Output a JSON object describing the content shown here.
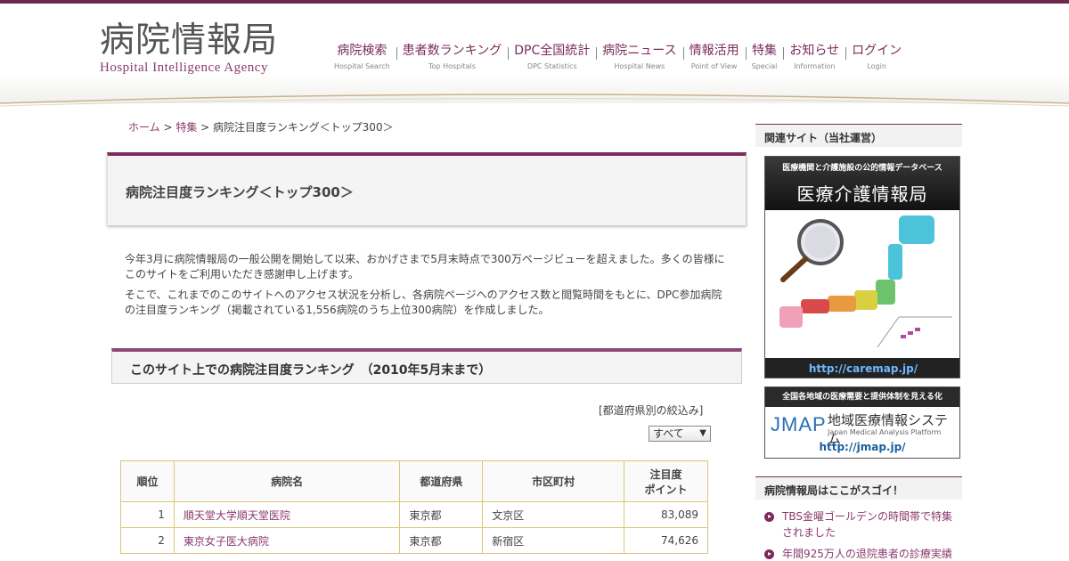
{
  "site": {
    "logo_ja": "病院情報局",
    "logo_en": "Hospital Intelligence Agency"
  },
  "nav": [
    {
      "ja": "病院検索",
      "en": "Hospital Search"
    },
    {
      "ja": "患者数ランキング",
      "en": "Top Hospitals"
    },
    {
      "ja": "DPC全国統計",
      "en": "DPC Statistics"
    },
    {
      "ja": "病院ニュース",
      "en": "Hospital News"
    },
    {
      "ja": "情報活用",
      "en": "Point of View"
    },
    {
      "ja": "特集",
      "en": "Special"
    },
    {
      "ja": "お知らせ",
      "en": "Information"
    },
    {
      "ja": "ログイン",
      "en": "Login"
    }
  ],
  "breadcrumb": {
    "home": "ホーム",
    "sep1": " > ",
    "special": "特集",
    "sep2": " > ",
    "current": "病院注目度ランキング＜トップ300＞"
  },
  "page_title": "病院注目度ランキング＜トップ300＞",
  "intro": {
    "p1": "今年3月に病院情報局の一般公開を開始して以来、おかげさまで5月末時点で300万ページビューを超えました。多くの皆様にこのサイトをご利用いただき感謝申し上げます。",
    "p2": "そこで、これまでのこのサイトへのアクセス状況を分析し、各病院ページへのアクセス数と閲覧時間をもとに、DPC参加病院の注目度ランキング（掲載されている1,556病院のうち上位300病院）を作成しました。"
  },
  "section_title": "このサイト上での病院注目度ランキング　（2010年5月末まで）",
  "filter": {
    "label": "[都道府県別の絞込み]",
    "selected": "すべて"
  },
  "table": {
    "headers": {
      "rank": "順位",
      "name": "病院名",
      "pref": "都道府県",
      "city": "市区町村",
      "points_line1": "注目度",
      "points_line2": "ポイント"
    },
    "rows": [
      {
        "rank": "1",
        "name": "順天堂大学順天堂医院",
        "pref": "東京都",
        "city": "文京区",
        "points": "83,089"
      },
      {
        "rank": "2",
        "name": "東京女子医大病院",
        "pref": "東京都",
        "city": "新宿区",
        "points": "74,626"
      }
    ]
  },
  "sidebar": {
    "related_heading": "関連サイト（当社運営）",
    "banner1": {
      "caption": "医療機関と介護施設の公的情報データベース",
      "title": "医療介護情報局",
      "url": "http://caremap.jp/"
    },
    "banner2": {
      "caption": "全国各地域の医療需要と提供体制を見える化",
      "logo": "JMAP",
      "name": "地域医療情報システム",
      "sub": "Japan Medical Analysis Platform",
      "url": "http://jmap.jp/"
    },
    "points_heading": "病院情報局はここがスゴイ！",
    "points": [
      "TBS金曜ゴールデンの時間帯で特集されました",
      "年間925万人の退院患者の診療実績"
    ]
  },
  "colors": {
    "brand": "#7b2c5c",
    "table_border": "#d9c77a"
  }
}
